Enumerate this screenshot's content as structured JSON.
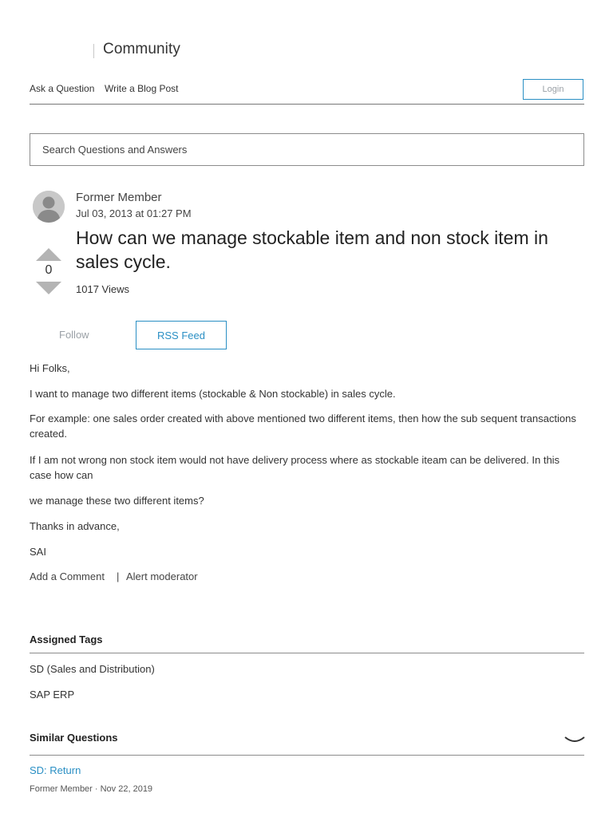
{
  "header": {
    "title": "Community"
  },
  "nav": {
    "ask": "Ask a Question",
    "blog": "Write a Blog Post",
    "login": "Login"
  },
  "search": {
    "placeholder": "Search Questions and Answers"
  },
  "question": {
    "author": "Former Member",
    "date": "Jul 03, 2013 at 01:27 PM",
    "title": "How can we manage stockable item and non stock item in sales cycle.",
    "votes": "0",
    "views": "1017 Views",
    "follow": "Follow",
    "rss": "RSS Feed",
    "body": [
      "Hi Folks,",
      "I want to manage two different items (stockable & Non stockable) in sales cycle.",
      "For example: one sales order created with above mentioned two different items, then how the sub sequent transactions created.",
      "If I am not wrong non stock item would not have delivery process where as stockable iteam can be delivered. In this case how can",
      "we manage these two different items?",
      "Thanks in advance,",
      "SAI"
    ],
    "add_comment": "Add a Comment",
    "separator": "|",
    "alert": "Alert moderator"
  },
  "tags": {
    "heading": "Assigned Tags",
    "items": [
      "SD (Sales and Distribution)",
      "SAP ERP"
    ]
  },
  "similar": {
    "heading": "Similar Questions",
    "items": [
      {
        "title": "SD: Return",
        "meta": "Former Member · Nov 22, 2019"
      }
    ]
  },
  "colors": {
    "accent": "#2a8fc4",
    "text": "#333333",
    "muted": "#9aa0a6"
  }
}
